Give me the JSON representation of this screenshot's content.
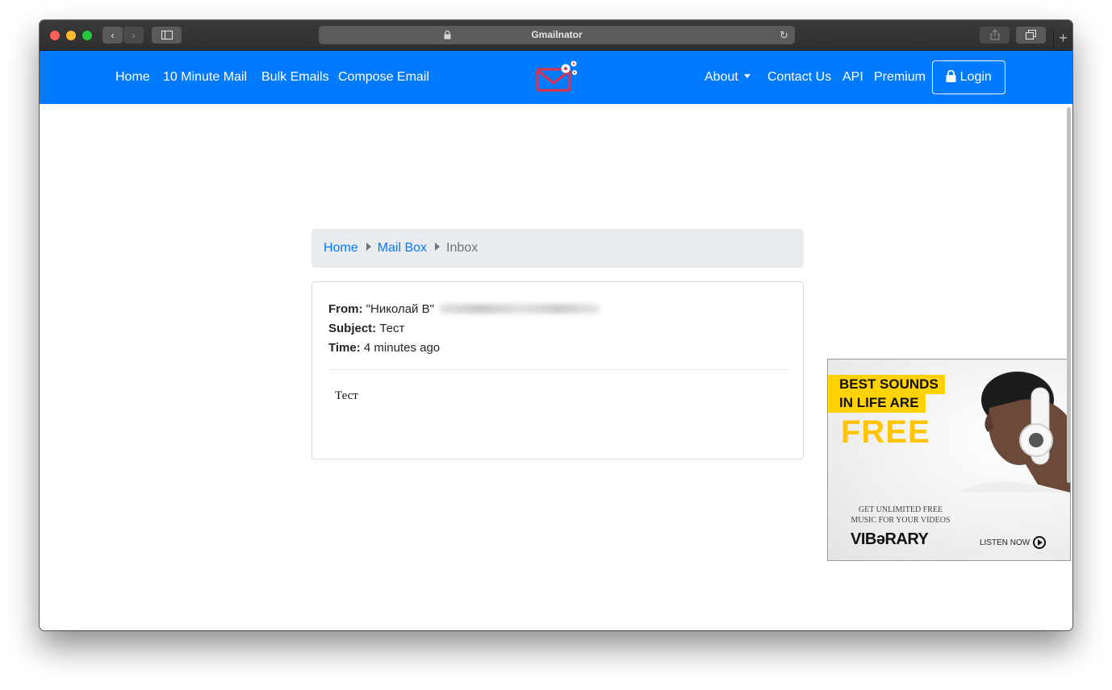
{
  "browser": {
    "address_title": "Gmailnator",
    "newtab_glyph": "+"
  },
  "nav": {
    "left_links": [
      "Home",
      "10 Minute Mail",
      "Bulk Emails",
      "Compose Email"
    ],
    "right_links": {
      "about": "About",
      "contact": "Contact Us",
      "api": "API",
      "premium": "Premium"
    },
    "login_label": "Login",
    "background_color": "#007bff"
  },
  "breadcrumb": {
    "items": [
      "Home",
      "Mail Box",
      "Inbox"
    ]
  },
  "email": {
    "from_label": "From:",
    "from_value": "\"Николай В\"",
    "subject_label": "Subject:",
    "subject_value": "Тест",
    "time_label": "Time:",
    "time_value": "4 minutes ago",
    "body": "Тест"
  },
  "ad": {
    "headline_1": "BEST SOUNDS",
    "headline_2": "IN LIFE ARE",
    "headline_3": "FREE",
    "subtext_1": "GET UNLIMITED FREE",
    "subtext_2": "MUSIC FOR YOUR VIDEOS",
    "brand": "VIBəRARY",
    "cta": "LISTEN NOW",
    "accent_color": "#ffd200"
  }
}
